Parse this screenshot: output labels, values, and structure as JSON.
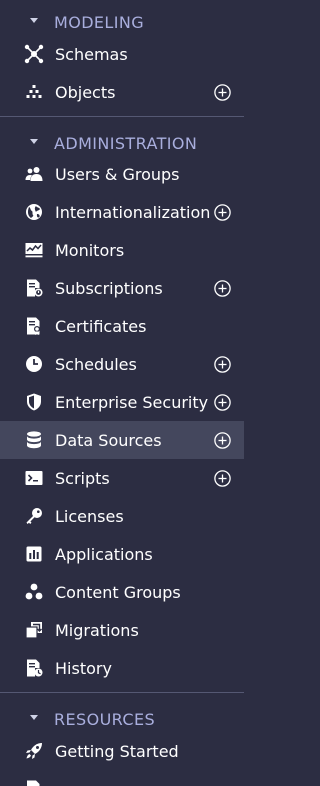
{
  "sections": {
    "modeling": {
      "title": "MODELING"
    },
    "administration": {
      "title": "ADMINISTRATION"
    },
    "resources": {
      "title": "RESOURCES"
    }
  },
  "modeling_items": [
    {
      "label": "Schemas",
      "icon": "schema-icon",
      "has_add": false
    },
    {
      "label": "Objects",
      "icon": "objects-icon",
      "has_add": true
    }
  ],
  "admin_items": [
    {
      "label": "Users & Groups",
      "icon": "users-icon",
      "has_add": false
    },
    {
      "label": "Internationalization",
      "icon": "globe-icon",
      "has_add": true
    },
    {
      "label": "Monitors",
      "icon": "monitor-icon",
      "has_add": false
    },
    {
      "label": "Subscriptions",
      "icon": "subscription-icon",
      "has_add": true
    },
    {
      "label": "Certificates",
      "icon": "certificate-icon",
      "has_add": false
    },
    {
      "label": "Schedules",
      "icon": "clock-icon",
      "has_add": true
    },
    {
      "label": "Enterprise Security",
      "icon": "shield-icon",
      "has_add": true
    },
    {
      "label": "Data Sources",
      "icon": "database-icon",
      "has_add": true,
      "active": true
    },
    {
      "label": "Scripts",
      "icon": "terminal-icon",
      "has_add": true
    },
    {
      "label": "Licenses",
      "icon": "key-icon",
      "has_add": false
    },
    {
      "label": "Applications",
      "icon": "applications-icon",
      "has_add": false
    },
    {
      "label": "Content Groups",
      "icon": "content-groups-icon",
      "has_add": false
    },
    {
      "label": "Migrations",
      "icon": "migrations-icon",
      "has_add": false
    },
    {
      "label": "History",
      "icon": "history-icon",
      "has_add": false
    }
  ],
  "resources_items": [
    {
      "label": "Getting Started",
      "icon": "rocket-icon",
      "has_add": false
    }
  ],
  "colors": {
    "background": "#2c2d42",
    "section_title": "#a9aedd",
    "active_row": "#44475d",
    "divider": "#555873"
  }
}
